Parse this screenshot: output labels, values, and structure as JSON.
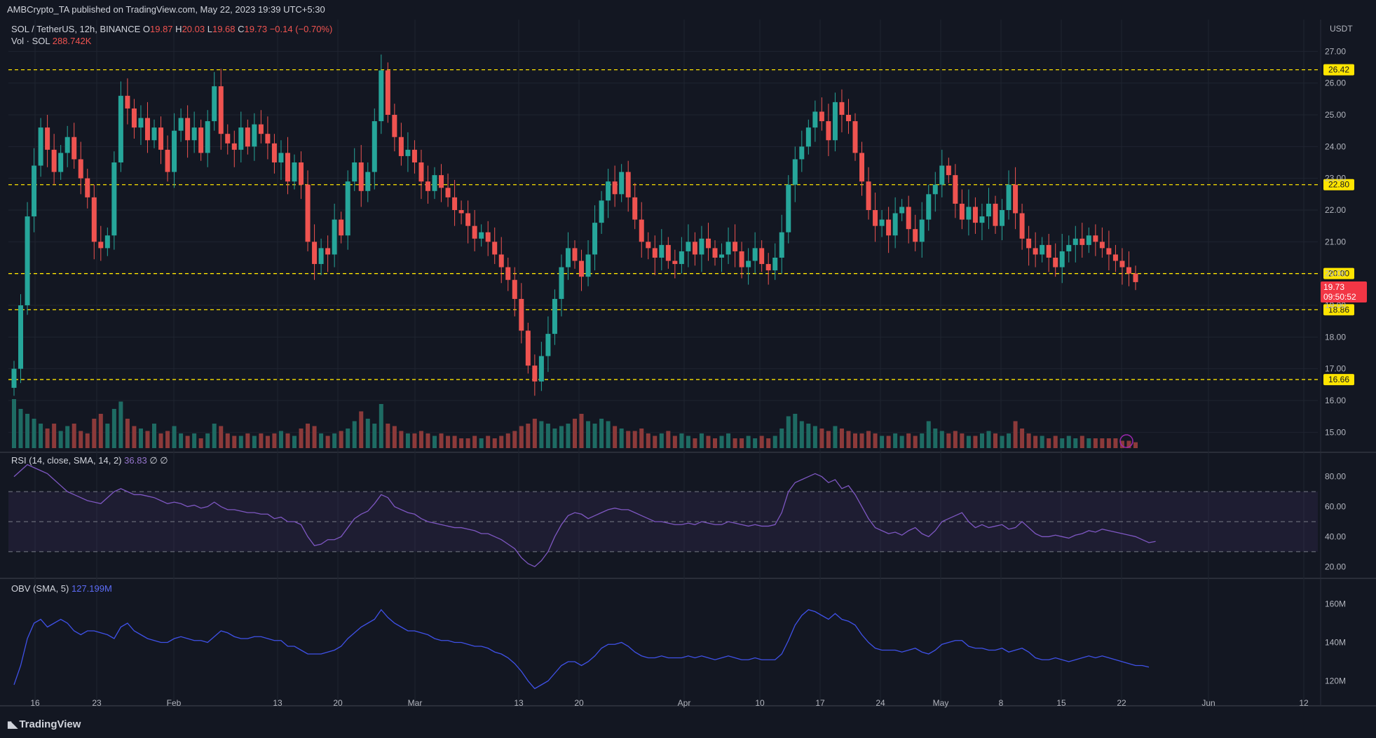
{
  "publisher": "AMBCrypto_TA published on TradingView.com, May 22, 2023 19:39 UTC+5:30",
  "symbol_line": {
    "symbol": "SOL / TetherUS, 12h, BINANCE",
    "o_label": "O",
    "o": "19.87",
    "h_label": "H",
    "h": "20.03",
    "l_label": "L",
    "l": "19.68",
    "c_label": "C",
    "c": "19.73",
    "change": "−0.14 (−0.70%)"
  },
  "vol_line": {
    "label": "Vol · SOL",
    "value": "288.742K"
  },
  "rsi_legend": {
    "label": "RSI (14, close, SMA, 14, 2)",
    "value": "36.83",
    "extra1": "∅",
    "extra2": "∅"
  },
  "obv_legend": {
    "label": "OBV (SMA, 5)",
    "value": "127.199M"
  },
  "footer_brand": "TradingView",
  "currency": "USDT",
  "colors": {
    "bg": "#131722",
    "up": "#26a69a",
    "down": "#ef5350",
    "level": "#ffe500",
    "rsi": "#7e57c2",
    "obv": "#3f51e8",
    "grid": "#1f2430",
    "text": "#b2b5be"
  },
  "chart_data": [
    {
      "type": "candlestick",
      "title": "SOL / TetherUS, 12h, BINANCE",
      "price_ticks": [
        "15.00",
        "16.00",
        "17.00",
        "18.00",
        "19.00",
        "20.00",
        "21.00",
        "22.00",
        "23.00",
        "24.00",
        "25.00",
        "26.00",
        "27.00"
      ],
      "ylim": [
        14.5,
        28.0
      ],
      "x_labels": [
        "16",
        "23",
        "Feb",
        "13",
        "20",
        "Mar",
        "13",
        "20",
        "Apr",
        "10",
        "17",
        "24",
        "May",
        "8",
        "15",
        "22",
        "Jun",
        "12"
      ],
      "levels": [
        "26.42",
        "22.80",
        "20.00",
        "18.86",
        "16.66"
      ],
      "current_price": "19.73",
      "countdown": "09:50:52",
      "closes": [
        17.0,
        19.0,
        21.8,
        23.4,
        24.6,
        23.9,
        23.2,
        23.8,
        24.3,
        23.6,
        23.0,
        22.4,
        21.0,
        20.8,
        21.2,
        23.5,
        25.6,
        25.2,
        24.6,
        24.9,
        24.2,
        24.6,
        23.9,
        23.2,
        24.5,
        24.9,
        24.2,
        24.6,
        23.8,
        24.8,
        25.9,
        24.4,
        24.1,
        23.9,
        24.6,
        24.0,
        24.7,
        24.4,
        24.1,
        23.5,
        23.8,
        22.9,
        23.5,
        22.8,
        21.0,
        20.3,
        20.8,
        20.6,
        21.7,
        21.2,
        22.9,
        23.5,
        22.6,
        23.2,
        24.8,
        26.4,
        25.0,
        24.3,
        23.7,
        23.9,
        23.5,
        22.9,
        22.6,
        23.1,
        22.7,
        22.4,
        22.0,
        21.9,
        21.5,
        21.1,
        21.3,
        21.0,
        20.6,
        20.2,
        19.8,
        19.2,
        18.2,
        17.1,
        16.6,
        17.4,
        18.1,
        19.2,
        20.2,
        20.8,
        20.4,
        19.9,
        20.6,
        21.6,
        22.3,
        22.9,
        22.5,
        23.2,
        22.4,
        21.7,
        21.0,
        20.8,
        20.5,
        20.9,
        20.4,
        20.3,
        20.7,
        21.0,
        20.6,
        21.1,
        20.8,
        20.5,
        20.6,
        21.0,
        20.7,
        20.2,
        20.4,
        20.8,
        20.3,
        20.1,
        20.5,
        21.3,
        22.8,
        23.6,
        24.0,
        24.6,
        25.1,
        24.8,
        24.2,
        25.4,
        25.0,
        24.8,
        23.8,
        22.9,
        22.0,
        21.5,
        21.7,
        21.2,
        21.9,
        22.1,
        21.4,
        21.0,
        21.7,
        22.5,
        22.8,
        23.4,
        23.1,
        22.2,
        21.7,
        22.1,
        21.6,
        21.8,
        22.2,
        21.5,
        22.0,
        22.8,
        21.9,
        21.1,
        20.8,
        20.6,
        20.9,
        20.5,
        20.2,
        20.7,
        20.9,
        21.1,
        20.9,
        21.2,
        21.0,
        20.8,
        20.6,
        20.4,
        20.2,
        20.0,
        19.73
      ],
      "volumes": [
        1.0,
        0.8,
        0.7,
        0.6,
        0.5,
        0.4,
        0.5,
        0.35,
        0.45,
        0.5,
        0.35,
        0.3,
        0.6,
        0.7,
        0.5,
        0.8,
        0.95,
        0.6,
        0.45,
        0.4,
        0.35,
        0.5,
        0.3,
        0.35,
        0.45,
        0.3,
        0.25,
        0.3,
        0.2,
        0.3,
        0.5,
        0.45,
        0.3,
        0.25,
        0.25,
        0.3,
        0.25,
        0.3,
        0.25,
        0.3,
        0.35,
        0.3,
        0.25,
        0.4,
        0.5,
        0.45,
        0.3,
        0.25,
        0.3,
        0.35,
        0.4,
        0.55,
        0.75,
        0.6,
        0.5,
        0.9,
        0.5,
        0.45,
        0.35,
        0.3,
        0.3,
        0.35,
        0.3,
        0.25,
        0.3,
        0.25,
        0.25,
        0.2,
        0.2,
        0.25,
        0.2,
        0.25,
        0.2,
        0.25,
        0.3,
        0.35,
        0.45,
        0.5,
        0.6,
        0.55,
        0.5,
        0.4,
        0.45,
        0.5,
        0.6,
        0.7,
        0.55,
        0.5,
        0.6,
        0.55,
        0.45,
        0.4,
        0.35,
        0.35,
        0.4,
        0.3,
        0.25,
        0.3,
        0.35,
        0.25,
        0.3,
        0.25,
        0.2,
        0.3,
        0.25,
        0.2,
        0.25,
        0.3,
        0.2,
        0.2,
        0.25,
        0.2,
        0.25,
        0.2,
        0.25,
        0.4,
        0.65,
        0.7,
        0.55,
        0.5,
        0.45,
        0.4,
        0.35,
        0.45,
        0.4,
        0.35,
        0.3,
        0.3,
        0.35,
        0.3,
        0.25,
        0.25,
        0.3,
        0.25,
        0.3,
        0.25,
        0.3,
        0.55,
        0.4,
        0.35,
        0.3,
        0.35,
        0.3,
        0.25,
        0.25,
        0.3,
        0.35,
        0.3,
        0.25,
        0.3,
        0.55,
        0.4,
        0.3,
        0.25,
        0.25,
        0.2,
        0.25,
        0.2,
        0.25,
        0.2,
        0.25,
        0.2,
        0.2,
        0.2,
        0.2,
        0.2,
        0.15,
        0.15,
        0.12
      ]
    },
    {
      "type": "line",
      "title": "RSI (14, close, SMA, 14, 2)",
      "ticks": [
        "20.00",
        "40.00",
        "60.00",
        "80.00"
      ],
      "ylim": [
        15,
        92
      ],
      "bands": [
        30,
        50,
        70
      ],
      "values": [
        80,
        84,
        88,
        86,
        84,
        82,
        78,
        74,
        70,
        68,
        66,
        64,
        63,
        62,
        66,
        70,
        72,
        70,
        68,
        68,
        67,
        66,
        64,
        62,
        63,
        62,
        60,
        61,
        59,
        60,
        63,
        60,
        58,
        58,
        57,
        56,
        56,
        55,
        55,
        52,
        53,
        50,
        50,
        48,
        40,
        34,
        35,
        38,
        38,
        40,
        46,
        52,
        55,
        57,
        62,
        68,
        66,
        60,
        58,
        56,
        55,
        52,
        50,
        49,
        48,
        47,
        46,
        46,
        45,
        44,
        42,
        42,
        40,
        38,
        35,
        32,
        26,
        22,
        20,
        24,
        30,
        40,
        48,
        54,
        56,
        55,
        52,
        54,
        56,
        58,
        59,
        58,
        58,
        56,
        54,
        52,
        50,
        50,
        49,
        48,
        48,
        49,
        48,
        50,
        49,
        48,
        48,
        50,
        49,
        48,
        47,
        48,
        47,
        47,
        48,
        56,
        70,
        76,
        78,
        80,
        82,
        80,
        76,
        78,
        72,
        74,
        68,
        60,
        52,
        46,
        44,
        42,
        43,
        41,
        44,
        46,
        42,
        40,
        44,
        50,
        52,
        54,
        56,
        50,
        46,
        48,
        46,
        47,
        48,
        45,
        46,
        50,
        46,
        42,
        40,
        40,
        41,
        40,
        39,
        41,
        42,
        44,
        43,
        45,
        44,
        43,
        42,
        41,
        40,
        38,
        36,
        36.83
      ]
    },
    {
      "type": "line",
      "title": "OBV (SMA, 5)",
      "ticks": [
        "120M",
        "140M",
        "160M"
      ],
      "ylim": [
        110,
        170
      ],
      "values": [
        118,
        128,
        142,
        150,
        152,
        148,
        150,
        152,
        150,
        146,
        144,
        146,
        146,
        145,
        144,
        142,
        148,
        150,
        146,
        144,
        142,
        141,
        140,
        140,
        142,
        143,
        142,
        141,
        141,
        140,
        143,
        146,
        145,
        143,
        142,
        142,
        143,
        143,
        142,
        141,
        141,
        138,
        138,
        136,
        134,
        134,
        134,
        135,
        136,
        138,
        142,
        145,
        148,
        150,
        152,
        157,
        153,
        150,
        148,
        146,
        146,
        145,
        144,
        142,
        141,
        141,
        140,
        140,
        139,
        138,
        138,
        137,
        135,
        134,
        132,
        129,
        125,
        120,
        116,
        118,
        120,
        124,
        128,
        130,
        130,
        128,
        130,
        133,
        137,
        139,
        139,
        140,
        138,
        135,
        133,
        132,
        132,
        133,
        132,
        132,
        132,
        133,
        132,
        133,
        132,
        131,
        132,
        133,
        132,
        131,
        131,
        132,
        131,
        131,
        131,
        134,
        141,
        149,
        154,
        157,
        156,
        154,
        152,
        155,
        152,
        151,
        149,
        144,
        140,
        137,
        136,
        136,
        136,
        135,
        136,
        137,
        135,
        134,
        136,
        139,
        140,
        141,
        141,
        138,
        137,
        137,
        136,
        136,
        137,
        135,
        136,
        137,
        135,
        132,
        131,
        131,
        132,
        131,
        130,
        131,
        132,
        133,
        132,
        133,
        132,
        131,
        130,
        129,
        128,
        128,
        127.2
      ]
    }
  ]
}
